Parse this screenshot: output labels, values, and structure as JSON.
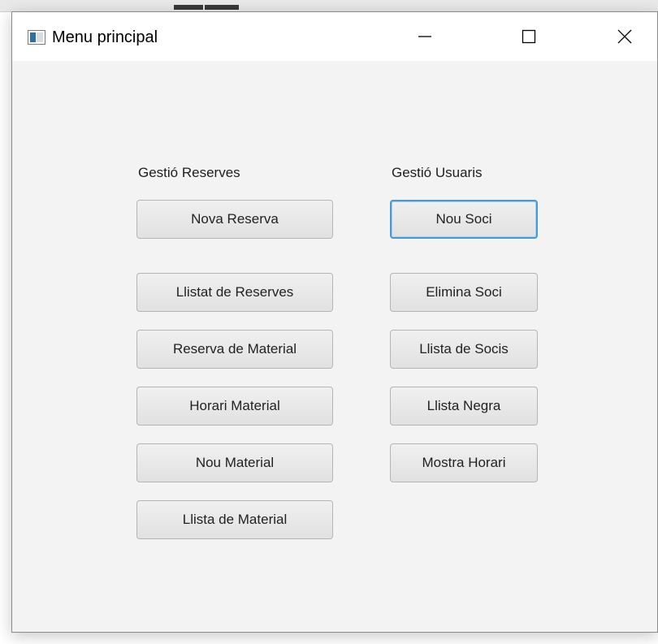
{
  "window": {
    "title": "Menu principal",
    "controls": {
      "minimize_icon": "minimize-icon",
      "maximize_icon": "maximize-icon",
      "close_icon": "close-icon"
    }
  },
  "reserves": {
    "label": "Gestió Reserves",
    "buttons": [
      "Nova Reserva",
      "Llistat de Reserves",
      "Reserva de Material",
      "Horari Material",
      "Nou Material",
      "Llista de Material"
    ]
  },
  "usuaris": {
    "label": "Gestió Usuaris",
    "buttons": [
      "Nou Soci",
      "Elimina Soci",
      "Llista de Socis",
      "Llista Negra",
      "Mostra Horari"
    ],
    "focused_index": 0
  },
  "colors": {
    "focus_ring": "#4a98d0",
    "window_bg": "#f3f3f3",
    "titlebar_bg": "#ffffff"
  }
}
